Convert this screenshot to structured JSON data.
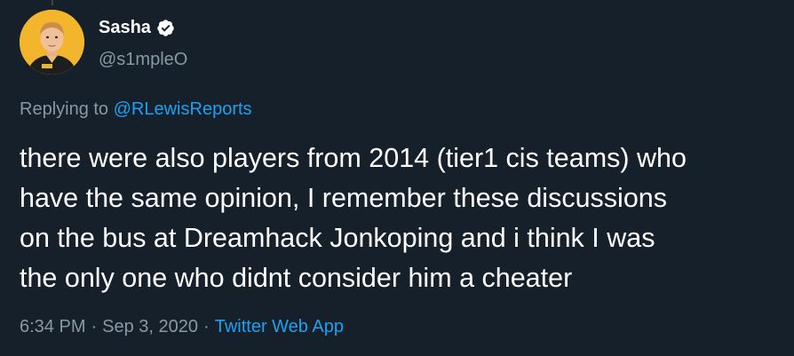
{
  "author": {
    "name": "Sasha",
    "handle": "@s1mpleO",
    "verified": true
  },
  "reply": {
    "prefix": "Replying to ",
    "target": "@RLewisReports"
  },
  "tweet": {
    "text": "there were also players from 2014 (tier1 cis teams) who\nhave the same opinion, I remember these discussions\non the bus at Dreamhack Jonkoping and i think I was\nthe only one who didnt consider him a cheater"
  },
  "meta": {
    "time": "6:34 PM",
    "separator": "·",
    "date": "Sep 3, 2020",
    "source": "Twitter Web App"
  },
  "colors": {
    "background": "#15202b",
    "text": "#ffffff",
    "secondary": "#8899a6",
    "link": "#1da1f2"
  }
}
